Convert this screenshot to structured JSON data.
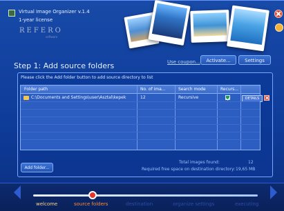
{
  "window": {
    "title": "Virtual Image Organizer v.1.4",
    "license": "1-year license",
    "brand": "REFERO",
    "brand_sub": "software"
  },
  "top_actions": {
    "use_coupon": "Use coupon...",
    "activate": "Activate...",
    "settings": "Settings"
  },
  "step": {
    "title": "Step 1: Add source folders",
    "instruction": "Please click the Add folder button to add source directory to list"
  },
  "table": {
    "headers": [
      "Folder path",
      "No. of ima...",
      "Search mode",
      "Recurs..."
    ],
    "rows": [
      {
        "path": "C:\\Documents and Settings\\user\\Asztal\\kepek",
        "count": "12",
        "mode": "Recursive",
        "recursive": true,
        "details_label": "DETAILS"
      }
    ]
  },
  "summary": {
    "total_label": "Total images found:",
    "total_value": "12",
    "space_label": "Required free space on destination directory:",
    "space_value": "19,65 MB"
  },
  "add_folder": "Add folder...",
  "nav": {
    "items": [
      "welcome",
      "source folders",
      "destination",
      "organize settings",
      "executing"
    ],
    "active_index": 1
  },
  "icons": {
    "app": "app-icon",
    "close": "close-icon",
    "minimize": "minimize-icon",
    "folder": "folder-icon",
    "check": "checkbox-icon",
    "remove": "remove-icon",
    "prev": "chevron-left-icon",
    "next": "chevron-right-icon"
  },
  "colors": {
    "accent": "#ff8b3a",
    "panel_border": "#7aa6ff",
    "background": "#0e3b98"
  }
}
